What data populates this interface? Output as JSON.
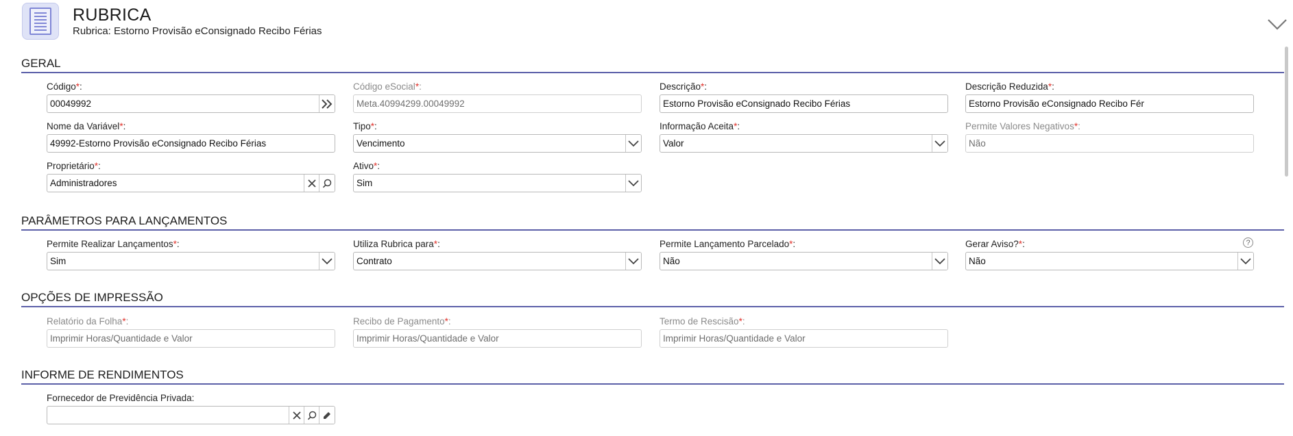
{
  "header": {
    "title": "RUBRICA",
    "subtitle": "Rubrica: Estorno Provisão eConsignado Recibo Férias"
  },
  "sections": {
    "geral": "GERAL",
    "parametros": "PARÂMETROS PARA LANÇAMENTOS",
    "impressao": "OPÇÕES DE IMPRESSÃO",
    "informe": "INFORME DE RENDIMENTOS"
  },
  "fields": {
    "codigo": {
      "label": "Código",
      "value": "00049992"
    },
    "codigo_esocial": {
      "label": "Código eSocial",
      "value": "Meta.40994299.00049992"
    },
    "descricao": {
      "label": "Descrição",
      "value": "Estorno Provisão eConsignado Recibo Férias"
    },
    "descricao_reduzida": {
      "label": "Descrição Reduzida",
      "value": "Estorno Provisão eConsignado Recibo Fér"
    },
    "nome_variavel": {
      "label": "Nome da Variável",
      "value": "49992-Estorno Provisão eConsignado Recibo Férias"
    },
    "tipo": {
      "label": "Tipo",
      "value": "Vencimento"
    },
    "informacao_aceita": {
      "label": "Informação Aceita",
      "value": "Valor"
    },
    "permite_negativos": {
      "label": "Permite Valores Negativos",
      "value": "Não"
    },
    "proprietario": {
      "label": "Proprietário",
      "value": "Administradores"
    },
    "ativo": {
      "label": "Ativo",
      "value": "Sim"
    },
    "permite_lancamentos": {
      "label": "Permite Realizar Lançamentos",
      "value": "Sim"
    },
    "utiliza_rubrica": {
      "label": "Utiliza Rubrica para",
      "value": "Contrato"
    },
    "lancamento_parcelado": {
      "label": "Permite Lançamento Parcelado",
      "value": "Não"
    },
    "gerar_aviso": {
      "label": "Gerar Aviso?",
      "value": "Não"
    },
    "relatorio_folha": {
      "label": "Relatório da Folha",
      "value": "Imprimir Horas/Quantidade e Valor"
    },
    "recibo_pagamento": {
      "label": "Recibo de Pagamento",
      "value": "Imprimir Horas/Quantidade e Valor"
    },
    "termo_rescisao": {
      "label": "Termo de Rescisão",
      "value": "Imprimir Horas/Quantidade e Valor"
    },
    "fornecedor_previdencia": {
      "label": "Fornecedor de Previdência Privada:",
      "value": ""
    }
  },
  "help_icon": "?",
  "colors": {
    "accent": "#5b5fa8",
    "required": "#e0312a"
  }
}
